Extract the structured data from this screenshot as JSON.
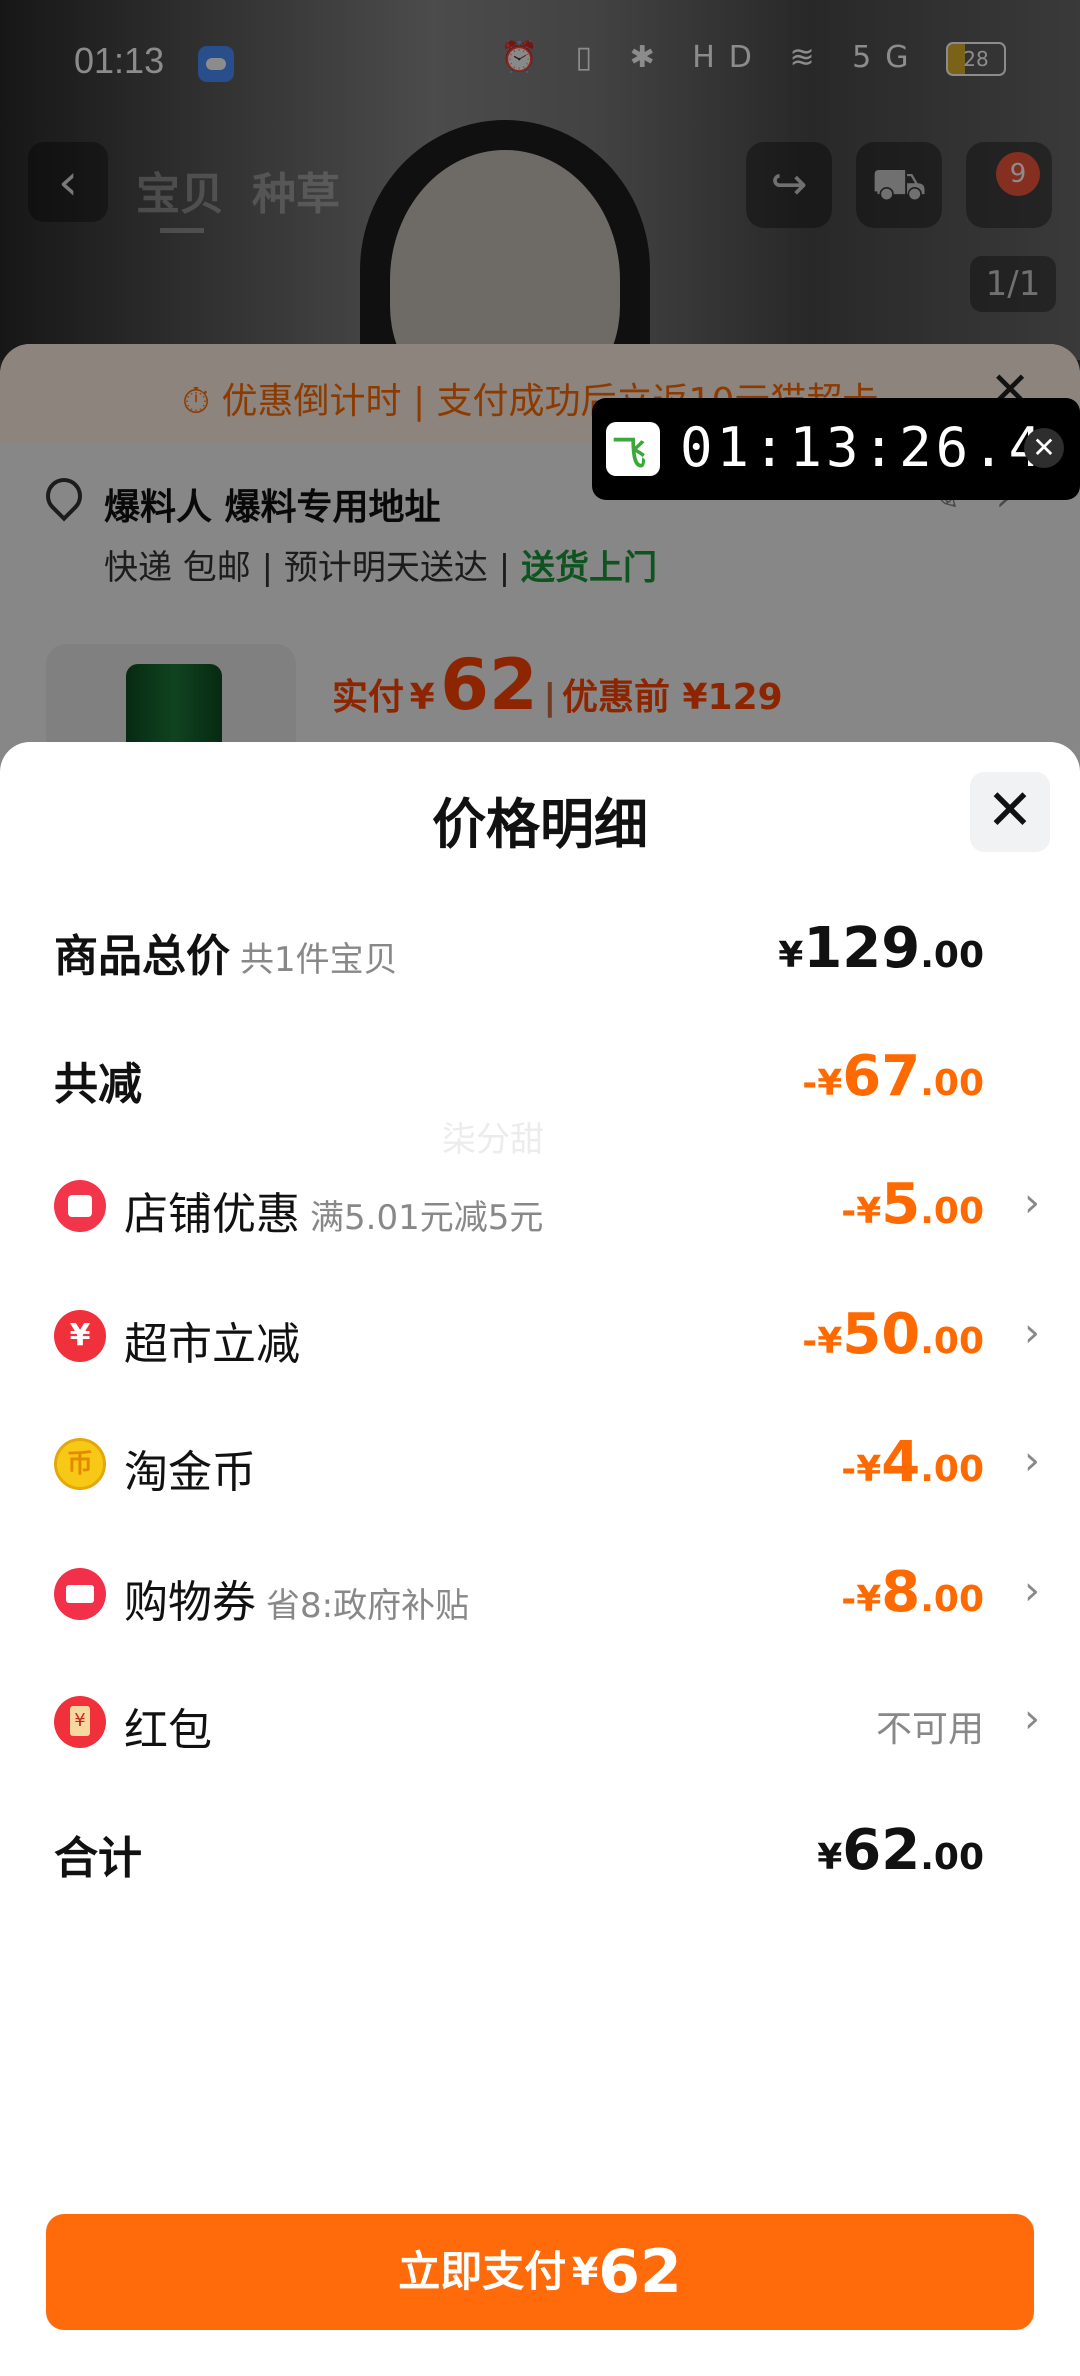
{
  "status_bar": {
    "time": "01:13",
    "battery": "28",
    "icons": "⏰ ▯ ✱ HD ≋ 5G"
  },
  "nav": {
    "tabs": [
      "宝贝",
      "种草"
    ],
    "cart_badge": "9",
    "page_indicator": "1/1"
  },
  "promo": {
    "text": "优惠倒计时 | 支付成功后立返10元猫超卡"
  },
  "address": {
    "name": "爆料人 爆料专用地址",
    "shipping": "快递 包邮",
    "eta": "预计明天送达",
    "delivery": "送货上门"
  },
  "order_price": {
    "paid_label": "实付",
    "currency": "¥",
    "paid": "62",
    "before_label": "优惠前 ¥129"
  },
  "timer": {
    "time": "01:13:26.4"
  },
  "sheet": {
    "title": "价格明细",
    "watermark": "柒分甜",
    "total": {
      "label": "商品总价",
      "sub": "共1件宝贝",
      "sym": "¥",
      "int": "129",
      "dec": ".00"
    },
    "reduce": {
      "label": "共减",
      "sym": "-¥",
      "int": "67",
      "dec": ".00"
    },
    "items": [
      {
        "label": "店铺优惠",
        "hint": "满5.01元减5元",
        "sym": "-¥",
        "int": "5",
        "dec": ".00"
      },
      {
        "label": "超市立减",
        "hint": "",
        "sym": "-¥",
        "int": "50",
        "dec": ".00"
      },
      {
        "label": "淘金币",
        "hint": "",
        "sym": "-¥",
        "int": "4",
        "dec": ".00"
      },
      {
        "label": "购物券",
        "hint": "省8:政府补贴",
        "sym": "-¥",
        "int": "8",
        "dec": ".00"
      },
      {
        "label": "红包",
        "hint": "",
        "status": "不可用"
      }
    ],
    "sum": {
      "label": "合计",
      "sym": "¥",
      "int": "62",
      "dec": ".00"
    },
    "pay_button": {
      "label": "立即支付",
      "sym": "¥",
      "value": "62"
    }
  },
  "colors": {
    "accent": "#ff6a0a",
    "discount": "#ff6a00",
    "green": "#1a9a3a"
  }
}
